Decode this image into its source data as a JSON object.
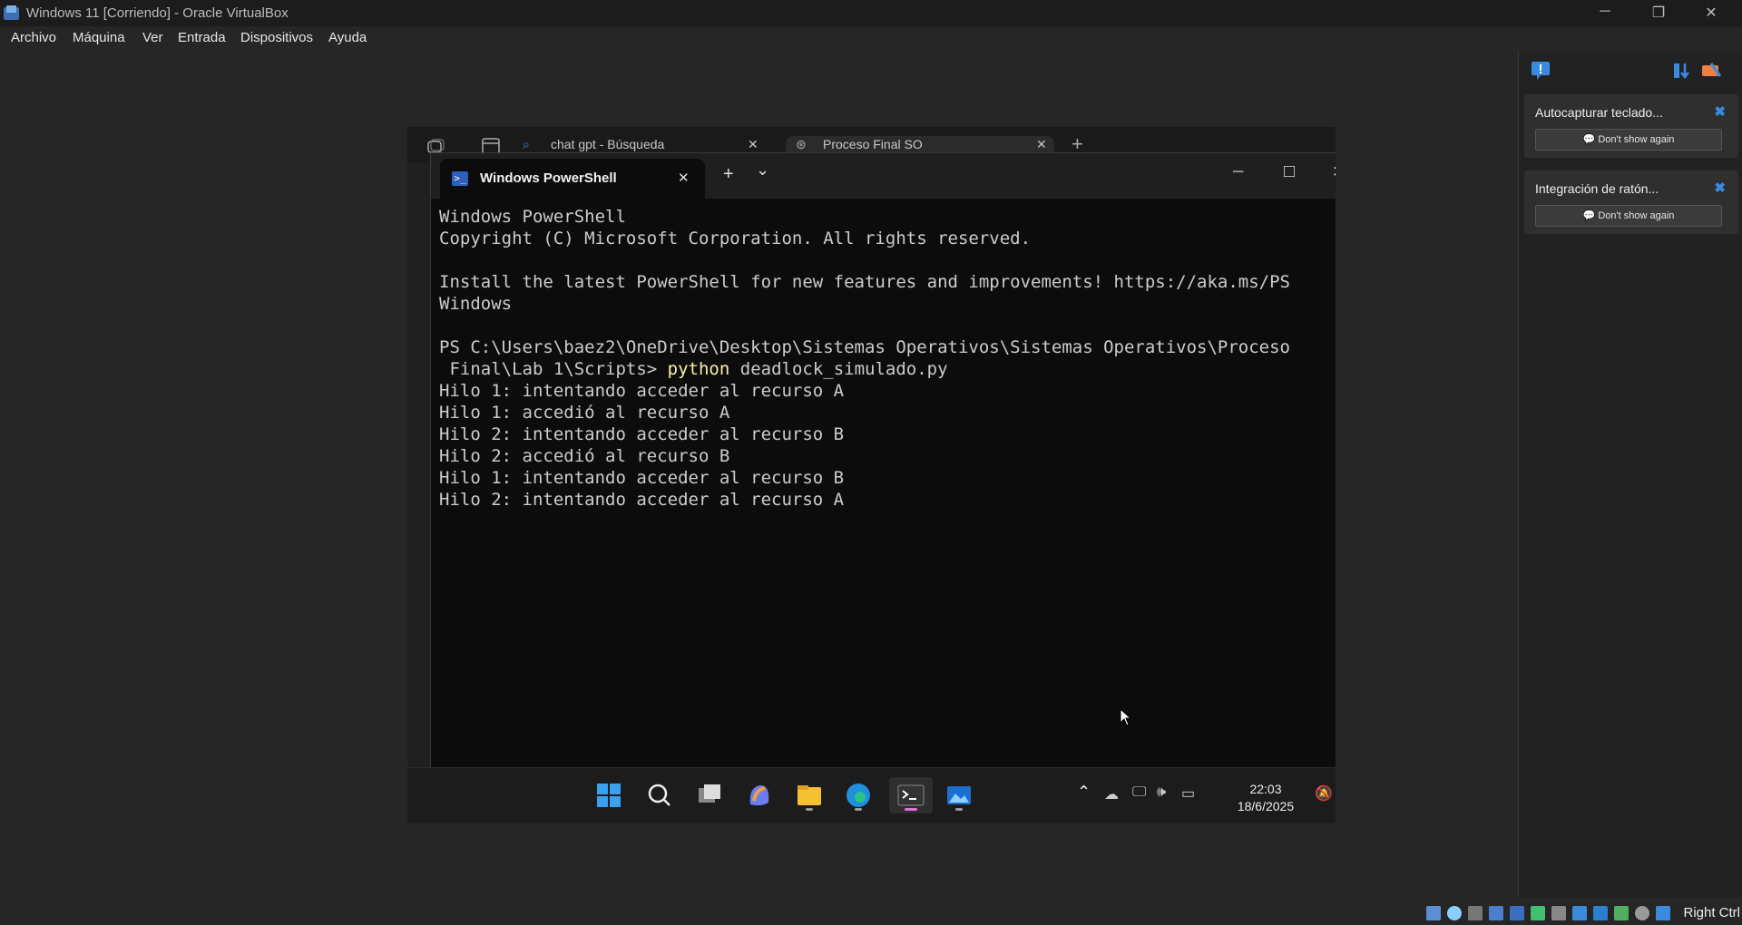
{
  "host_window": {
    "title": "Windows 11 [Corriendo] - Oracle VirtualBox",
    "controls": {
      "minimize": "─",
      "restore": "❐",
      "close": "✕"
    }
  },
  "menu": [
    "Archivo",
    "Máquina",
    "Ver",
    "Entrada",
    "Dispositivos",
    "Ayuda"
  ],
  "edge": {
    "tabs": [
      {
        "label": "chat gpt - Búsqueda",
        "close": "✕"
      },
      {
        "label": "Proceso Final SO",
        "close": "✕"
      }
    ],
    "new_tab": "+"
  },
  "terminal": {
    "tab_title": "Windows PowerShell",
    "tab_close": "✕",
    "new_tab": "+",
    "dropdown": "⌄",
    "controls": {
      "minimize": "─",
      "maximize": "□",
      "close": "✕"
    },
    "lines": [
      "Windows PowerShell",
      "Copyright (C) Microsoft Corporation. All rights reserved.",
      "",
      "Install the latest PowerShell for new features and improvements! https://aka.ms/PS",
      "Windows",
      "",
      "PS C:\\Users\\baez2\\OneDrive\\Desktop\\Sistemas Operativos\\Sistemas Operativos\\Proceso",
      " Final\\Lab 1\\Scripts> "
    ],
    "command": {
      "keyword": "python",
      "args": " deadlock_simulado.py"
    },
    "output": [
      "Hilo 1: intentando acceder al recurso A",
      "Hilo 1: accedió al recurso A",
      "Hilo 2: intentando acceder al recurso B",
      "Hilo 2: accedió al recurso B",
      "Hilo 1: intentando acceder al recurso B",
      "Hilo 2: intentando acceder al recurso A"
    ]
  },
  "taskbar": {
    "time": "22:03",
    "date": "18/6/2025",
    "icons": [
      "start-icon",
      "search-icon",
      "task-view-icon",
      "copilot-icon",
      "file-explorer-icon",
      "edge-icon",
      "terminal-icon",
      "photos-icon"
    ]
  },
  "notifications": [
    {
      "title": "Autocapturar teclado...",
      "button": "Don't show again",
      "close": "✖"
    },
    {
      "title": "Integración de ratón...",
      "button": "Don't show again",
      "close": "✖"
    }
  ],
  "statusbar": {
    "host_key": "Right Ctrl"
  },
  "colors": {
    "accent": "#3a8bdf",
    "terminal_bg": "#0c0c0c",
    "command": "#f9f1a5"
  }
}
